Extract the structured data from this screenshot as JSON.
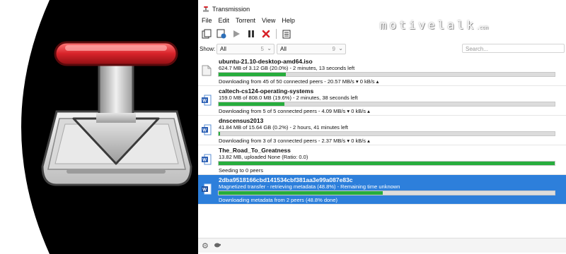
{
  "window": {
    "title": "Transmission"
  },
  "menu": [
    "File",
    "Edit",
    "Torrent",
    "View",
    "Help"
  ],
  "toolbar": [
    {
      "name": "open-torrent-icon"
    },
    {
      "name": "open-url-icon"
    },
    {
      "name": "start-icon"
    },
    {
      "name": "pause-icon"
    },
    {
      "name": "remove-icon"
    },
    {
      "name": "properties-icon"
    }
  ],
  "brand": {
    "text": "motivelalk",
    "suffix": ".com"
  },
  "filter": {
    "show_label": "Show:",
    "status": {
      "value": "All",
      "count": "5"
    },
    "tracker": {
      "value": "All",
      "count": "9"
    },
    "search_placeholder": "Search..."
  },
  "torrents": [
    {
      "name": "ubuntu-21.10-desktop-amd64.iso",
      "progress_text": "624.7 MB of 3.12 GB (20.0%) - 2 minutes, 13 seconds left",
      "progress": 0.2,
      "status": "Downloading from 45 of 50 connected peers - 20.57 MB/s ▾  0 kB/s ▴",
      "icon": "file-icon",
      "selected": false
    },
    {
      "name": "caltech-cs124-operating-systems",
      "progress_text": "159.0 MB of 808.0 MB (19.6%) - 2 minutes, 38 seconds left",
      "progress": 0.196,
      "status": "Downloading from 5 of 5 connected peers - 4.09 MB/s ▾  0 kB/s ▴",
      "icon": "word-doc-icon",
      "selected": false
    },
    {
      "name": "dnscensus2013",
      "progress_text": "41.84 MB of 15.64 GB (0.2%) - 2 hours, 41 minutes left",
      "progress": 0.002,
      "status": "Downloading from 3 of 3 connected peers - 2.37 MB/s ▾  0 kB/s ▴",
      "icon": "word-doc-icon",
      "selected": false
    },
    {
      "name": "The_Road_To_Greatness",
      "progress_text": "13.82 MB, uploaded None (Ratio: 0.0)",
      "progress": 1.0,
      "status": "Seeding to 0 peers",
      "icon": "word-doc-icon",
      "selected": false
    },
    {
      "name": "2dba9518166cbd141534cbf381aa3e99a087e83c",
      "progress_text": "Magnetized transfer - retrieving metadata (48.8%) - Remaining time unknown",
      "progress": 0.488,
      "status": "Downloading metadata from 2 peers (48.8% done)",
      "icon": "word-doc-icon",
      "selected": true
    }
  ],
  "colors": {
    "selection": "#2d7fdb",
    "progress": "#27ad3d",
    "accent_red": "#d8232a"
  },
  "logo": {
    "name": "transmission-logo-icon"
  }
}
